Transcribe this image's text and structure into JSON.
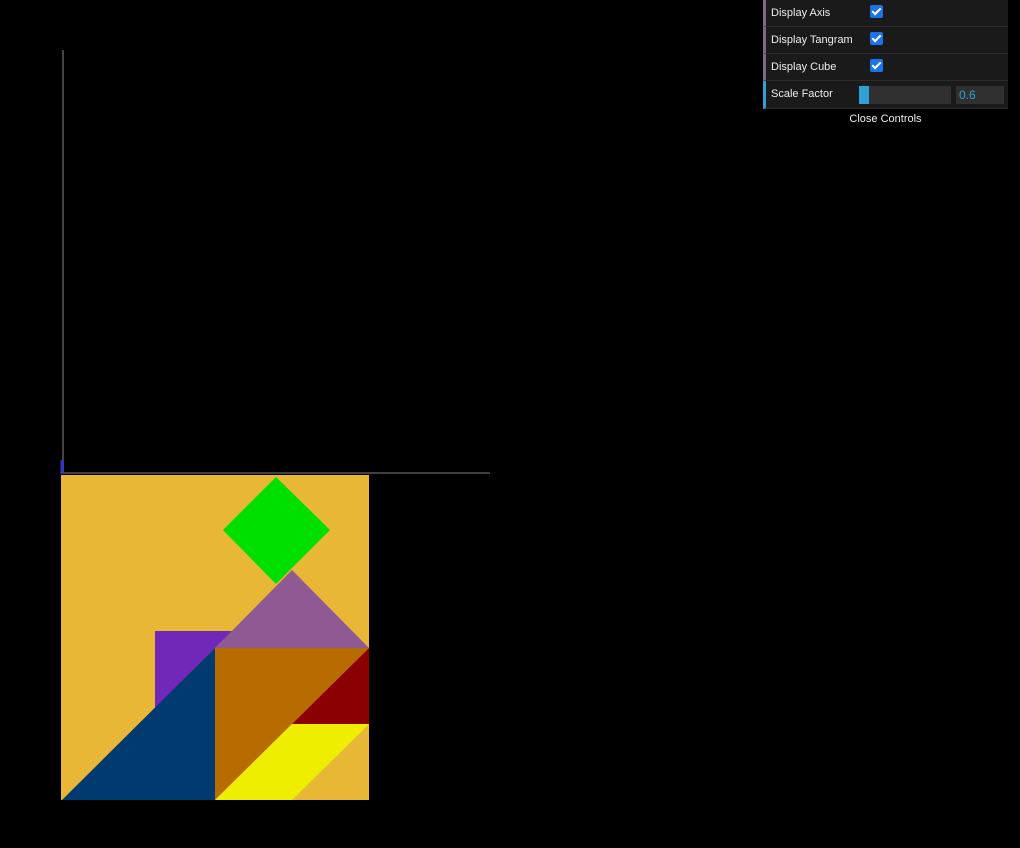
{
  "controls": {
    "display_axis": {
      "label": "Display Axis",
      "checked": true
    },
    "display_tangram": {
      "label": "Display Tangram",
      "checked": true
    },
    "display_cube": {
      "label": "Display Cube",
      "checked": true
    },
    "scale_factor": {
      "label": "Scale Factor",
      "value": "0.6"
    },
    "close_label": "Close Controls"
  },
  "colors": {
    "background": "#000000",
    "board": "#E8B735",
    "square": "#00E000",
    "medium_triangle": "#8F5A93",
    "small_purple_triangle": "#7128B8",
    "large_blue_triangle": "#003A70",
    "large_orange_triangle": "#B86C00",
    "small_red_triangle": "#8B0000",
    "parallelogram": "#EEEE00",
    "axis_x": "#555555",
    "axis_y": "#444444",
    "axis_z": "#3333CC"
  }
}
